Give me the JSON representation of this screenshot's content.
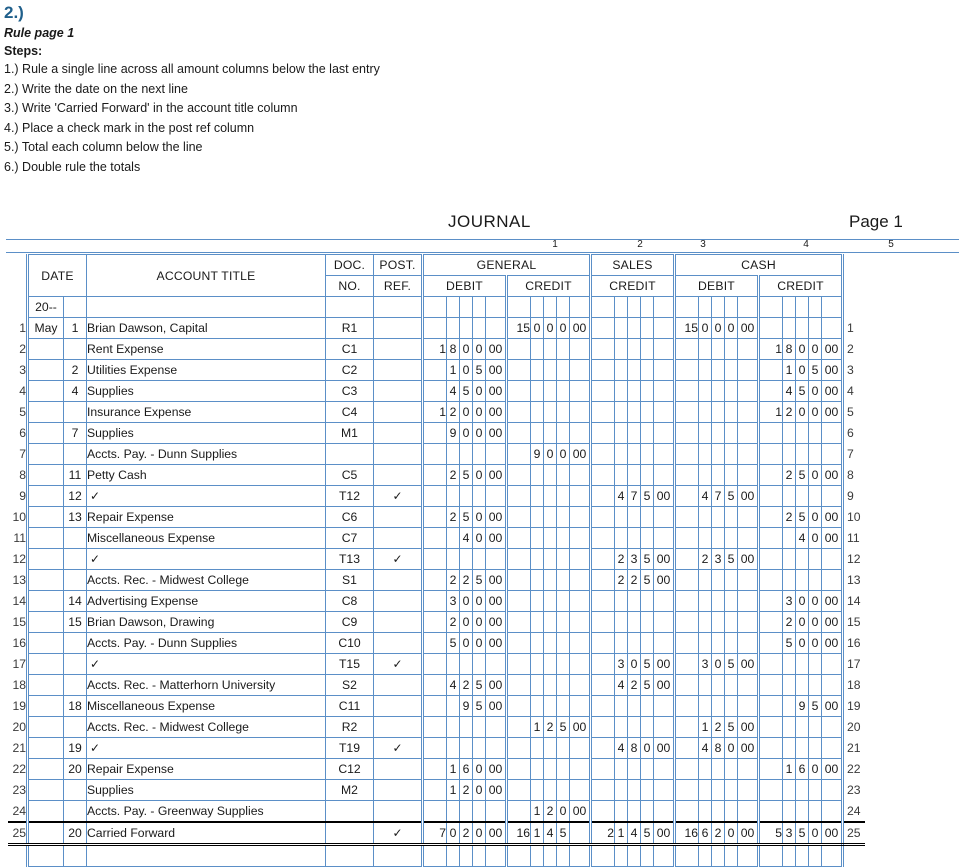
{
  "instructions": {
    "question_number": "2.)",
    "rule_page": "Rule page 1",
    "steps_label": "Steps:",
    "steps": [
      "1.) Rule a single line across all amount columns below the last entry",
      "2.) Write the date on the next line",
      "3.) Write 'Carried Forward' in the account title column",
      "4.) Place a check mark in the post ref column",
      "5.) Total each column below the line",
      "6.) Double rule the totals"
    ]
  },
  "journal": {
    "title": "JOURNAL",
    "page_label": "Page 1",
    "column_numbers": [
      "1",
      "2",
      "3",
      "4",
      "5"
    ],
    "headers": {
      "date": "DATE",
      "account_title": "ACCOUNT TITLE",
      "doc_no_line1": "DOC.",
      "doc_no_line2": "NO.",
      "post_ref_line1": "POST.",
      "post_ref_line2": "REF.",
      "general": "GENERAL",
      "sales": "SALES",
      "cash": "CASH",
      "debit": "DEBIT",
      "credit": "CREDIT"
    },
    "year_row": "20--",
    "check_mark": "✓",
    "rows": [
      {
        "n": "1",
        "month": "May",
        "day": "1",
        "title": "Brian Dawson, Capital",
        "doc": "R1",
        "pref": "",
        "gd": [
          "",
          "",
          "",
          "",
          ""
        ],
        "gc": [
          "15",
          "0",
          "0",
          "0",
          "00"
        ],
        "sc": [
          "",
          "",
          "",
          "",
          ""
        ],
        "cd": [
          "15",
          "0",
          "0",
          "0",
          "00"
        ],
        "cc": [
          "",
          "",
          "",
          "",
          ""
        ]
      },
      {
        "n": "2",
        "month": "",
        "day": "",
        "title": "Rent Expense",
        "doc": "C1",
        "pref": "",
        "gd": [
          "1",
          "8",
          "0",
          "0",
          "00"
        ],
        "gc": [
          "",
          "",
          "",
          "",
          ""
        ],
        "sc": [
          "",
          "",
          "",
          "",
          ""
        ],
        "cd": [
          "",
          "",
          "",
          "",
          ""
        ],
        "cc": [
          "1",
          "8",
          "0",
          "0",
          "00"
        ]
      },
      {
        "n": "3",
        "month": "",
        "day": "2",
        "title": "Utilities Expense",
        "doc": "C2",
        "pref": "",
        "gd": [
          "",
          "1",
          "0",
          "5",
          "00"
        ],
        "gc": [
          "",
          "",
          "",
          "",
          ""
        ],
        "sc": [
          "",
          "",
          "",
          "",
          ""
        ],
        "cd": [
          "",
          "",
          "",
          "",
          ""
        ],
        "cc": [
          "",
          "1",
          "0",
          "5",
          "00"
        ]
      },
      {
        "n": "4",
        "month": "",
        "day": "4",
        "title": "Supplies",
        "doc": "C3",
        "pref": "",
        "gd": [
          "",
          "4",
          "5",
          "0",
          "00"
        ],
        "gc": [
          "",
          "",
          "",
          "",
          ""
        ],
        "sc": [
          "",
          "",
          "",
          "",
          ""
        ],
        "cd": [
          "",
          "",
          "",
          "",
          ""
        ],
        "cc": [
          "",
          "4",
          "5",
          "0",
          "00"
        ]
      },
      {
        "n": "5",
        "month": "",
        "day": "",
        "title": "Insurance Expense",
        "doc": "C4",
        "pref": "",
        "gd": [
          "1",
          "2",
          "0",
          "0",
          "00"
        ],
        "gc": [
          "",
          "",
          "",
          "",
          ""
        ],
        "sc": [
          "",
          "",
          "",
          "",
          ""
        ],
        "cd": [
          "",
          "",
          "",
          "",
          ""
        ],
        "cc": [
          "1",
          "2",
          "0",
          "0",
          "00"
        ]
      },
      {
        "n": "6",
        "month": "",
        "day": "7",
        "title": "Supplies",
        "doc": "M1",
        "pref": "",
        "gd": [
          "",
          "9",
          "0",
          "0",
          "00"
        ],
        "gc": [
          "",
          "",
          "",
          "",
          ""
        ],
        "sc": [
          "",
          "",
          "",
          "",
          ""
        ],
        "cd": [
          "",
          "",
          "",
          "",
          ""
        ],
        "cc": [
          "",
          "",
          "",
          "",
          ""
        ]
      },
      {
        "n": "7",
        "month": "",
        "day": "",
        "title": "Accts. Pay. - Dunn Supplies",
        "doc": "",
        "pref": "",
        "gd": [
          "",
          "",
          "",
          "",
          ""
        ],
        "gc": [
          "",
          "9",
          "0",
          "0",
          "00"
        ],
        "sc": [
          "",
          "",
          "",
          "",
          ""
        ],
        "cd": [
          "",
          "",
          "",
          "",
          ""
        ],
        "cc": [
          "",
          "",
          "",
          "",
          ""
        ]
      },
      {
        "n": "8",
        "month": "",
        "day": "11",
        "title": "Petty Cash",
        "doc": "C5",
        "pref": "",
        "gd": [
          "",
          "2",
          "5",
          "0",
          "00"
        ],
        "gc": [
          "",
          "",
          "",
          "",
          ""
        ],
        "sc": [
          "",
          "",
          "",
          "",
          ""
        ],
        "cd": [
          "",
          "",
          "",
          "",
          ""
        ],
        "cc": [
          "",
          "2",
          "5",
          "0",
          "00"
        ]
      },
      {
        "n": "9",
        "month": "",
        "day": "12",
        "title": "✓",
        "doc": "T12",
        "pref": "✓",
        "gd": [
          "",
          "",
          "",
          "",
          ""
        ],
        "gc": [
          "",
          "",
          "",
          "",
          ""
        ],
        "sc": [
          "",
          "4",
          "7",
          "5",
          "00"
        ],
        "cd": [
          "",
          "4",
          "7",
          "5",
          "00"
        ],
        "cc": [
          "",
          "",
          "",
          "",
          ""
        ]
      },
      {
        "n": "10",
        "month": "",
        "day": "13",
        "title": "Repair Expense",
        "doc": "C6",
        "pref": "",
        "gd": [
          "",
          "2",
          "5",
          "0",
          "00"
        ],
        "gc": [
          "",
          "",
          "",
          "",
          ""
        ],
        "sc": [
          "",
          "",
          "",
          "",
          ""
        ],
        "cd": [
          "",
          "",
          "",
          "",
          ""
        ],
        "cc": [
          "",
          "2",
          "5",
          "0",
          "00"
        ]
      },
      {
        "n": "11",
        "month": "",
        "day": "",
        "title": "Miscellaneous Expense",
        "doc": "C7",
        "pref": "",
        "gd": [
          "",
          "",
          "4",
          "0",
          "00"
        ],
        "gc": [
          "",
          "",
          "",
          "",
          ""
        ],
        "sc": [
          "",
          "",
          "",
          "",
          ""
        ],
        "cd": [
          "",
          "",
          "",
          "",
          ""
        ],
        "cc": [
          "",
          "",
          "4",
          "0",
          "00"
        ]
      },
      {
        "n": "12",
        "month": "",
        "day": "",
        "title": "✓",
        "doc": "T13",
        "pref": "✓",
        "gd": [
          "",
          "",
          "",
          "",
          ""
        ],
        "gc": [
          "",
          "",
          "",
          "",
          ""
        ],
        "sc": [
          "",
          "2",
          "3",
          "5",
          "00"
        ],
        "cd": [
          "",
          "2",
          "3",
          "5",
          "00"
        ],
        "cc": [
          "",
          "",
          "",
          "",
          ""
        ]
      },
      {
        "n": "13",
        "month": "",
        "day": "",
        "title": "Accts. Rec. - Midwest College",
        "doc": "S1",
        "pref": "",
        "gd": [
          "",
          "2",
          "2",
          "5",
          "00"
        ],
        "gc": [
          "",
          "",
          "",
          "",
          ""
        ],
        "sc": [
          "",
          "2",
          "2",
          "5",
          "00"
        ],
        "cd": [
          "",
          "",
          "",
          "",
          ""
        ],
        "cc": [
          "",
          "",
          "",
          "",
          ""
        ]
      },
      {
        "n": "14",
        "month": "",
        "day": "14",
        "title": "Advertising Expense",
        "doc": "C8",
        "pref": "",
        "gd": [
          "",
          "3",
          "0",
          "0",
          "00"
        ],
        "gc": [
          "",
          "",
          "",
          "",
          ""
        ],
        "sc": [
          "",
          "",
          "",
          "",
          ""
        ],
        "cd": [
          "",
          "",
          "",
          "",
          ""
        ],
        "cc": [
          "",
          "3",
          "0",
          "0",
          "00"
        ]
      },
      {
        "n": "15",
        "month": "",
        "day": "15",
        "title": "Brian Dawson, Drawing",
        "doc": "C9",
        "pref": "",
        "gd": [
          "",
          "2",
          "0",
          "0",
          "00"
        ],
        "gc": [
          "",
          "",
          "",
          "",
          ""
        ],
        "sc": [
          "",
          "",
          "",
          "",
          ""
        ],
        "cd": [
          "",
          "",
          "",
          "",
          ""
        ],
        "cc": [
          "",
          "2",
          "0",
          "0",
          "00"
        ]
      },
      {
        "n": "16",
        "month": "",
        "day": "",
        "title": "Accts. Pay. - Dunn Supplies",
        "doc": "C10",
        "pref": "",
        "gd": [
          "",
          "5",
          "0",
          "0",
          "00"
        ],
        "gc": [
          "",
          "",
          "",
          "",
          ""
        ],
        "sc": [
          "",
          "",
          "",
          "",
          ""
        ],
        "cd": [
          "",
          "",
          "",
          "",
          ""
        ],
        "cc": [
          "",
          "5",
          "0",
          "0",
          "00"
        ]
      },
      {
        "n": "17",
        "month": "",
        "day": "",
        "title": "✓",
        "doc": "T15",
        "pref": "✓",
        "gd": [
          "",
          "",
          "",
          "",
          ""
        ],
        "gc": [
          "",
          "",
          "",
          "",
          ""
        ],
        "sc": [
          "",
          "3",
          "0",
          "5",
          "00"
        ],
        "cd": [
          "",
          "3",
          "0",
          "5",
          "00"
        ],
        "cc": [
          "",
          "",
          "",
          "",
          ""
        ]
      },
      {
        "n": "18",
        "month": "",
        "day": "",
        "title": "Accts. Rec. - Matterhorn University",
        "doc": "S2",
        "pref": "",
        "gd": [
          "",
          "4",
          "2",
          "5",
          "00"
        ],
        "gc": [
          "",
          "",
          "",
          "",
          ""
        ],
        "sc": [
          "",
          "4",
          "2",
          "5",
          "00"
        ],
        "cd": [
          "",
          "",
          "",
          "",
          ""
        ],
        "cc": [
          "",
          "",
          "",
          "",
          ""
        ]
      },
      {
        "n": "19",
        "month": "",
        "day": "18",
        "title": "Miscellaneous Expense",
        "doc": "C11",
        "pref": "",
        "gd": [
          "",
          "",
          "9",
          "5",
          "00"
        ],
        "gc": [
          "",
          "",
          "",
          "",
          ""
        ],
        "sc": [
          "",
          "",
          "",
          "",
          ""
        ],
        "cd": [
          "",
          "",
          "",
          "",
          ""
        ],
        "cc": [
          "",
          "",
          "9",
          "5",
          "00"
        ]
      },
      {
        "n": "20",
        "month": "",
        "day": "",
        "title": "Accts. Rec. - Midwest College",
        "doc": "R2",
        "pref": "",
        "gd": [
          "",
          "",
          "",
          "",
          ""
        ],
        "gc": [
          "",
          "1",
          "2",
          "5",
          "00"
        ],
        "sc": [
          "",
          "",
          "",
          "",
          ""
        ],
        "cd": [
          "",
          "1",
          "2",
          "5",
          "00"
        ],
        "cc": [
          "",
          "",
          "",
          "",
          ""
        ]
      },
      {
        "n": "21",
        "month": "",
        "day": "19",
        "title": "✓",
        "doc": "T19",
        "pref": "✓",
        "gd": [
          "",
          "",
          "",
          "",
          ""
        ],
        "gc": [
          "",
          "",
          "",
          "",
          ""
        ],
        "sc": [
          "",
          "4",
          "8",
          "0",
          "00"
        ],
        "cd": [
          "",
          "4",
          "8",
          "0",
          "00"
        ],
        "cc": [
          "",
          "",
          "",
          "",
          ""
        ]
      },
      {
        "n": "22",
        "month": "",
        "day": "20",
        "title": "Repair Expense",
        "doc": "C12",
        "pref": "",
        "gd": [
          "",
          "1",
          "6",
          "0",
          "00"
        ],
        "gc": [
          "",
          "",
          "",
          "",
          ""
        ],
        "sc": [
          "",
          "",
          "",
          "",
          ""
        ],
        "cd": [
          "",
          "",
          "",
          "",
          ""
        ],
        "cc": [
          "",
          "1",
          "6",
          "0",
          "00"
        ]
      },
      {
        "n": "23",
        "month": "",
        "day": "",
        "title": "Supplies",
        "doc": "M2",
        "pref": "",
        "gd": [
          "",
          "1",
          "2",
          "0",
          "00"
        ],
        "gc": [
          "",
          "",
          "",
          "",
          ""
        ],
        "sc": [
          "",
          "",
          "",
          "",
          ""
        ],
        "cd": [
          "",
          "",
          "",
          "",
          ""
        ],
        "cc": [
          "",
          "",
          "",
          "",
          ""
        ]
      },
      {
        "n": "24",
        "month": "",
        "day": "",
        "title": "Accts. Pay. - Greenway Supplies",
        "doc": "",
        "pref": "",
        "gd": [
          "",
          "",
          "",
          "",
          ""
        ],
        "gc": [
          "",
          "1",
          "2",
          "0",
          "00"
        ],
        "sc": [
          "",
          "",
          "",
          "",
          ""
        ],
        "cd": [
          "",
          "",
          "",
          "",
          ""
        ],
        "cc": [
          "",
          "",
          "",
          "",
          ""
        ]
      },
      {
        "n": "25",
        "month": "",
        "day": "20",
        "title": "Carried Forward",
        "doc": "",
        "pref": "✓",
        "gd": [
          "7",
          "0",
          "2",
          "0",
          "00"
        ],
        "gc": [
          "16",
          "1",
          "4",
          "5",
          ""
        ],
        "sc": [
          "2",
          "1",
          "4",
          "5",
          "00"
        ],
        "cd": [
          "16",
          "6",
          "2",
          "0",
          "00"
        ],
        "cc": [
          "5",
          "3",
          "5",
          "0",
          "00"
        ]
      }
    ]
  },
  "colors": {
    "grid": "#5b8fc7",
    "heading": "#1f5f8b",
    "rule": "#000000",
    "text": "#1a1a1a"
  }
}
